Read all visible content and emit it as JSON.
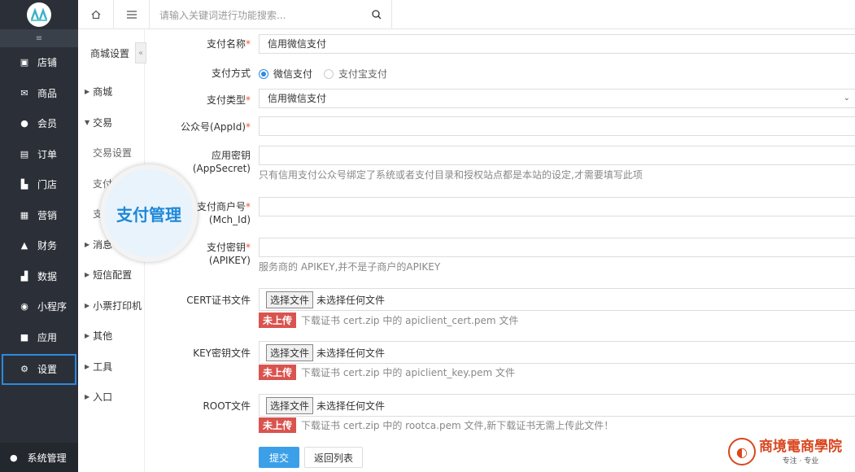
{
  "sidebar": {
    "items": [
      {
        "label": "店铺",
        "icon": "store-icon",
        "glyph": "▣"
      },
      {
        "label": "商品",
        "icon": "goods-icon",
        "glyph": "✉"
      },
      {
        "label": "会员",
        "icon": "member-icon",
        "glyph": "●"
      },
      {
        "label": "订单",
        "icon": "order-icon",
        "glyph": "▤"
      },
      {
        "label": "门店",
        "icon": "shop-icon",
        "glyph": "▙"
      },
      {
        "label": "营销",
        "icon": "marketing-icon",
        "glyph": "▦"
      },
      {
        "label": "财务",
        "icon": "finance-icon",
        "glyph": "▲"
      },
      {
        "label": "数据",
        "icon": "data-icon",
        "glyph": "▟"
      },
      {
        "label": "小程序",
        "icon": "miniprogram-icon",
        "glyph": "◉"
      },
      {
        "label": "应用",
        "icon": "apps-icon",
        "glyph": "■"
      },
      {
        "label": "设置",
        "icon": "gear-icon",
        "glyph": "⚙"
      }
    ],
    "bottom_label": "系统管理",
    "bottom_icon_glyph": "●"
  },
  "topbar": {
    "search_placeholder": "请输入关键词进行功能搜索..."
  },
  "subnav": {
    "title": "商城设置",
    "items": [
      {
        "label": "商城",
        "expanded": false
      },
      {
        "label": "交易",
        "expanded": true
      },
      {
        "label": "交易设置",
        "child": true
      },
      {
        "label": "支付",
        "child": true
      },
      {
        "label": "支",
        "child": true
      },
      {
        "label": "消息",
        "expanded": false
      },
      {
        "label": "短信配置",
        "expanded": false
      },
      {
        "label": "小票打印机",
        "expanded": false
      },
      {
        "label": "其他",
        "expanded": false
      },
      {
        "label": "工具",
        "expanded": false
      },
      {
        "label": "入口",
        "expanded": false
      }
    ],
    "magnifier_text": "支付管理"
  },
  "form": {
    "pay_name_label": "支付名称",
    "pay_name_value": "信用微信支付",
    "pay_method_label": "支付方式",
    "radio_wechat": "微信支付",
    "radio_alipay": "支付宝支付",
    "pay_type_label": "支付类型",
    "pay_type_value": "信用微信支付",
    "appid_label": "公众号(AppId)",
    "appsecret_label_1": "应用密钥",
    "appsecret_label_2": "(AppSecret)",
    "appsecret_hint": "只有信用支付公众号绑定了系统或者支付目录和授权站点都是本站的设定,才需要填写此项",
    "mchid_label_1": "支付商户号",
    "mchid_label_2": "(Mch_Id)",
    "apikey_label_1": "支付密钥",
    "apikey_label_2": "(APIKEY)",
    "apikey_hint": "服务商的 APIKEY,并不是子商户的APIKEY",
    "cert_label": "CERT证书文件",
    "key_label": "KEY密钥文件",
    "root_label": "ROOT文件",
    "choose_file": "选择文件",
    "no_file": "未选择任何文件",
    "not_uploaded": "未上传",
    "cert_hint": "下载证书 cert.zip 中的 apiclient_cert.pem 文件",
    "key_hint": "下载证书 cert.zip 中的 apiclient_key.pem 文件",
    "root_hint": "下载证书 cert.zip 中的 rootca.pem 文件,新下载证书无需上传此文件！",
    "submit": "提交",
    "back": "返回列表"
  },
  "watermark": {
    "main": "商境電商學院",
    "sub": "专注 · 专业"
  },
  "colors": {
    "sidebar_bg": "#2b3038",
    "accent": "#2d8ae0",
    "submit_bg": "#3ca0e9",
    "badge_bg": "#d9534f"
  }
}
